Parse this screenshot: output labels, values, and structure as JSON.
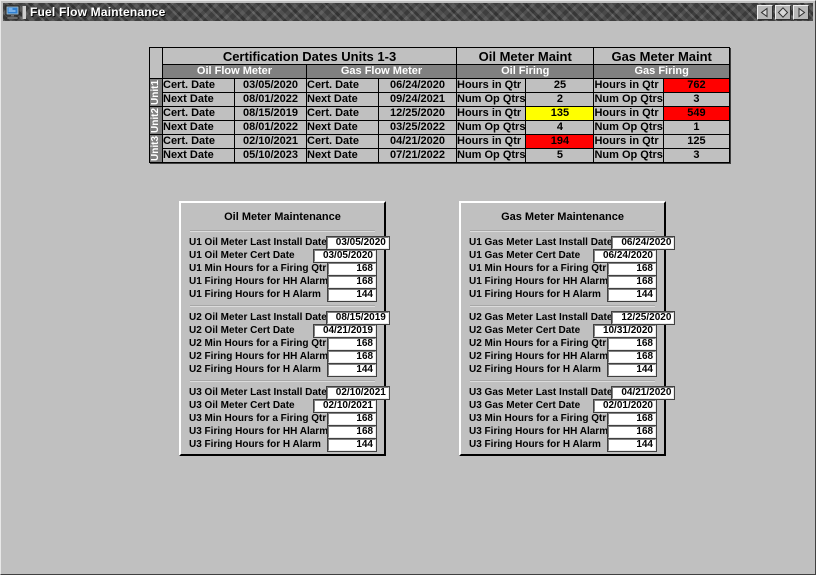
{
  "window": {
    "title": "Fuel Flow Maintenance",
    "icon": "computer-monitor-icon",
    "background_color": "#c0c0c0",
    "titlebar_color": "#4a4a4a",
    "buttons": [
      {
        "name": "prev-record-button",
        "glyph": "<"
      },
      {
        "name": "record-selector-button",
        "glyph": "diamond"
      },
      {
        "name": "next-record-button",
        "glyph": ">"
      }
    ]
  },
  "cert_table": {
    "group_headers": [
      {
        "label": "Certification Dates Units 1-3",
        "span": 4
      },
      {
        "label": "Oil Meter Maint",
        "span": 2
      },
      {
        "label": "Gas Meter Maint",
        "span": 2
      }
    ],
    "sub_headers": [
      {
        "label": "Oil Flow Meter",
        "span": 2
      },
      {
        "label": "Gas Flow Meter",
        "span": 2
      },
      {
        "label": "Oil Firing",
        "span": 2
      },
      {
        "label": "Gas Firing",
        "span": 2
      }
    ],
    "units": [
      {
        "unit_label": "Unit1",
        "rows": [
          {
            "oil_flow_label": "Cert. Date",
            "oil_flow_value": "03/05/2020",
            "oil_flow_state": "normal",
            "gas_flow_label": "Cert. Date",
            "gas_flow_value": "06/24/2020",
            "gas_flow_state": "normal",
            "oil_fire_label": "Hours in Qtr",
            "oil_fire_value": "25",
            "oil_fire_state": "normal",
            "gas_fire_label": "Hours in Qtr",
            "gas_fire_value": "762",
            "gas_fire_state": "red"
          },
          {
            "oil_flow_label": "Next Date",
            "oil_flow_value": "08/01/2022",
            "oil_flow_state": "normal",
            "gas_flow_label": "Next Date",
            "gas_flow_value": "09/24/2021",
            "gas_flow_state": "normal",
            "oil_fire_label": "Num Op Qtrs",
            "oil_fire_value": "2",
            "oil_fire_state": "normal",
            "gas_fire_label": "Num Op Qtrs",
            "gas_fire_value": "3",
            "gas_fire_state": "normal"
          }
        ]
      },
      {
        "unit_label": "Unit2",
        "rows": [
          {
            "oil_flow_label": "Cert. Date",
            "oil_flow_value": "08/15/2019",
            "oil_flow_state": "normal",
            "gas_flow_label": "Cert. Date",
            "gas_flow_value": "12/25/2020",
            "gas_flow_state": "normal",
            "oil_fire_label": "Hours in Qtr",
            "oil_fire_value": "135",
            "oil_fire_state": "yellow",
            "gas_fire_label": "Hours in Qtr",
            "gas_fire_value": "549",
            "gas_fire_state": "red"
          },
          {
            "oil_flow_label": "Next Date",
            "oil_flow_value": "08/01/2022",
            "oil_flow_state": "normal",
            "gas_flow_label": "Next Date",
            "gas_flow_value": "03/25/2022",
            "gas_flow_state": "normal",
            "oil_fire_label": "Num Op Qtrs",
            "oil_fire_value": "4",
            "oil_fire_state": "normal",
            "gas_fire_label": "Num Op Qtrs",
            "gas_fire_value": "1",
            "gas_fire_state": "normal"
          }
        ]
      },
      {
        "unit_label": "Unit3",
        "rows": [
          {
            "oil_flow_label": "Cert. Date",
            "oil_flow_value": "02/10/2021",
            "oil_flow_state": "normal",
            "gas_flow_label": "Cert. Date",
            "gas_flow_value": "04/21/2020",
            "gas_flow_state": "normal",
            "oil_fire_label": "Hours in Qtr",
            "oil_fire_value": "194",
            "oil_fire_state": "red",
            "gas_fire_label": "Hours in Qtr",
            "gas_fire_value": "125",
            "gas_fire_state": "normal"
          },
          {
            "oil_flow_label": "Next Date",
            "oil_flow_value": "05/10/2023",
            "oil_flow_state": "normal",
            "gas_flow_label": "Next Date",
            "gas_flow_value": "07/21/2022",
            "gas_flow_state": "normal",
            "oil_fire_label": "Num Op Qtrs",
            "oil_fire_value": "5",
            "oil_fire_state": "normal",
            "gas_fire_label": "Num Op Qtrs",
            "gas_fire_value": "3",
            "gas_fire_state": "normal"
          }
        ]
      }
    ],
    "alert_colors": {
      "red": "#ff0000",
      "yellow": "#ffff00",
      "normal": "#c0c0c0"
    }
  },
  "oil_panel": {
    "title": "Oil Meter Maintenance",
    "groups": [
      {
        "fields": [
          {
            "label": "U1 Oil Meter Last Install Date",
            "value": "03/05/2020",
            "type": "date"
          },
          {
            "label": "U1 Oil Meter Cert Date",
            "value": "03/05/2020",
            "type": "date"
          },
          {
            "label": "U1 Min Hours for a Firing Qtr",
            "value": "168",
            "type": "num"
          },
          {
            "label": "U1 Firing Hours for HH Alarm",
            "value": "168",
            "type": "num"
          },
          {
            "label": "U1 Firing Hours for H Alarm",
            "value": "144",
            "type": "num"
          }
        ]
      },
      {
        "fields": [
          {
            "label": "U2 Oil Meter Last Install Date",
            "value": "08/15/2019",
            "type": "date"
          },
          {
            "label": "U2 Oil Meter Cert Date",
            "value": "04/21/2019",
            "type": "date"
          },
          {
            "label": "U2 Min Hours for a Firing Qtr",
            "value": "168",
            "type": "num"
          },
          {
            "label": "U2 Firing Hours for HH Alarm",
            "value": "168",
            "type": "num"
          },
          {
            "label": "U2 Firing Hours for H Alarm",
            "value": "144",
            "type": "num"
          }
        ]
      },
      {
        "fields": [
          {
            "label": "U3 Oil Meter Last Install Date",
            "value": "02/10/2021",
            "type": "date"
          },
          {
            "label": "U3 Oil Meter Cert Date",
            "value": "02/10/2021",
            "type": "date"
          },
          {
            "label": "U3 Min Hours for a Firing Qtr",
            "value": "168",
            "type": "num"
          },
          {
            "label": "U3 Firing Hours for HH Alarm",
            "value": "168",
            "type": "num"
          },
          {
            "label": "U3 Firing Hours for H Alarm",
            "value": "144",
            "type": "num"
          }
        ]
      }
    ]
  },
  "gas_panel": {
    "title": "Gas Meter Maintenance",
    "groups": [
      {
        "fields": [
          {
            "label": "U1 Gas Meter Last Install Date",
            "value": "06/24/2020",
            "type": "date"
          },
          {
            "label": "U1 Gas Meter Cert Date",
            "value": "06/24/2020",
            "type": "date"
          },
          {
            "label": "U1 Min Hours for a Firing Qtr",
            "value": "168",
            "type": "num"
          },
          {
            "label": "U1 Firing Hours for HH Alarm",
            "value": "168",
            "type": "num"
          },
          {
            "label": "U1 Firing Hours for H Alarm",
            "value": "144",
            "type": "num"
          }
        ]
      },
      {
        "fields": [
          {
            "label": "U2 Gas Meter Last Install Date",
            "value": "12/25/2020",
            "type": "date"
          },
          {
            "label": "U2 Gas Meter Cert Date",
            "value": "10/31/2020",
            "type": "date"
          },
          {
            "label": "U2 Min Hours for a Firing Qtr",
            "value": "168",
            "type": "num"
          },
          {
            "label": "U2 Firing Hours for HH Alarm",
            "value": "168",
            "type": "num"
          },
          {
            "label": "U2 Firing Hours for H Alarm",
            "value": "144",
            "type": "num"
          }
        ]
      },
      {
        "fields": [
          {
            "label": "U3 Gas Meter Last Install Date",
            "value": "04/21/2020",
            "type": "date"
          },
          {
            "label": "U3 Gas Meter Cert Date",
            "value": "02/01/2020",
            "type": "date"
          },
          {
            "label": "U3 Min Hours for a Firing Qtr",
            "value": "168",
            "type": "num"
          },
          {
            "label": "U3 Firing Hours for HH Alarm",
            "value": "168",
            "type": "num"
          },
          {
            "label": "U3 Firing Hours for H Alarm",
            "value": "144",
            "type": "num"
          }
        ]
      }
    ]
  }
}
